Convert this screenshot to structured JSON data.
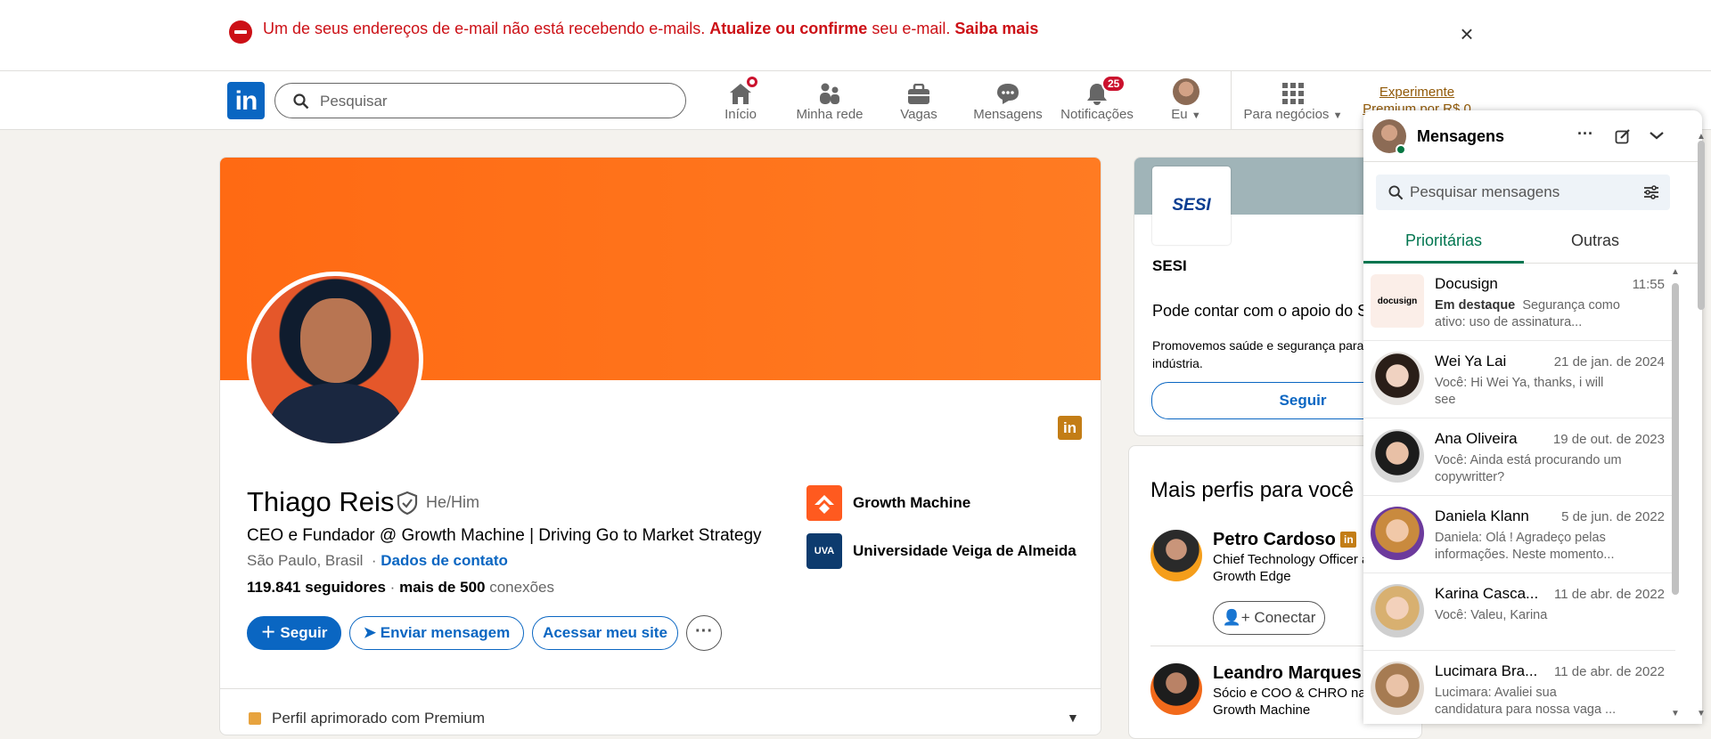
{
  "alert": {
    "text_part1": "Um de seus endereços de e-mail não está recebendo e-mails.",
    "link1": "Atualize ou confirme",
    "text_part2": "seu e-mail.",
    "link2": "Saiba mais",
    "close": "×"
  },
  "nav": {
    "logo": "in",
    "search_placeholder": "Pesquisar",
    "items": [
      {
        "label": "Início"
      },
      {
        "label": "Minha rede"
      },
      {
        "label": "Vagas"
      },
      {
        "label": "Mensagens"
      },
      {
        "label": "Notificações",
        "badge": "25"
      },
      {
        "label": "Eu"
      },
      {
        "label": "Para negócios"
      }
    ],
    "premium_line1": "Experimente",
    "premium_line2": "Premium por R$ 0"
  },
  "profile": {
    "name": "Thiago Reis",
    "pronouns": "He/Him",
    "headline": "CEO e Fundador @ Growth Machine | Driving Go to Market Strategy",
    "location": "São Paulo, Brasil",
    "contact_link": "Dados de contato",
    "followers": "119.841 seguidores",
    "separator": "·",
    "connections_bold": "mais de 500",
    "connections_label": "conexões",
    "follow_btn": "Seguir",
    "message_btn": "Enviar mensagem",
    "site_btn": "Acessar meu site",
    "more_btn": "···",
    "org1": "Growth Machine",
    "org2": "Universidade Veiga de Almeida",
    "org2_logo": "UVA",
    "premium_row": "Perfil aprimorado com Premium",
    "in_badge": "in"
  },
  "sesi": {
    "logo": "SESI",
    "name": "SESI",
    "message": "Pode contar com o apoio do SESI",
    "description": "Promovemos saúde e segurança para a indústria.",
    "follow_btn": "Seguir"
  },
  "people": {
    "title": "Mais perfis para você",
    "list": [
      {
        "name": "Petro Cardoso",
        "desc": "Chief Technology Officer at Growth Edge",
        "btn": "Conectar",
        "in": "in"
      },
      {
        "name": "Leandro Marques",
        "desc": "Sócio e COO & CHRO na Growth Machine"
      }
    ]
  },
  "messaging": {
    "title": "Mensagens",
    "search_placeholder": "Pesquisar mensagens",
    "tab_focused": "Prioritárias",
    "tab_other": "Outras",
    "conversations": [
      {
        "name": "Docusign",
        "date": "11:55",
        "tag": "Em destaque",
        "preview": "Segurança como ativo: uso de assinatura..."
      },
      {
        "name": "Wei Ya Lai",
        "date": "21 de jan. de 2024",
        "preview": "Você: Hi Wei Ya, thanks, i will see"
      },
      {
        "name": "Ana Oliveira",
        "date": "19 de out. de 2023",
        "preview": "Você: Ainda está procurando um copywritter?"
      },
      {
        "name": "Daniela Klann",
        "date": "5 de jun. de 2022",
        "preview": "Daniela: Olá ! Agradeço pelas informações. Neste momento..."
      },
      {
        "name": "Karina Casca...",
        "date": "11 de abr. de 2022",
        "preview": "Você: Valeu, Karina"
      },
      {
        "name": "Lucimara Bra...",
        "date": "11 de abr. de 2022",
        "preview": "Lucimara: Avaliei sua candidatura para nossa vaga ..."
      }
    ]
  },
  "colors": {
    "brand": "#0a66c2",
    "alert": "#cc1016",
    "banner": "#ff6a13",
    "active_tab": "#01754f"
  }
}
